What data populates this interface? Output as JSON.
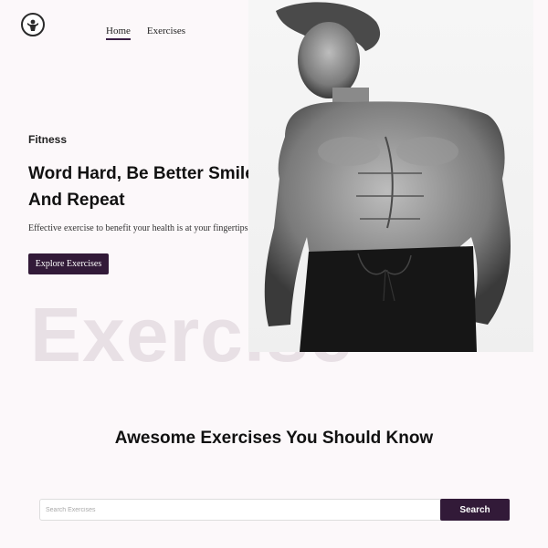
{
  "nav": {
    "home": "Home",
    "exercises": "Exercises"
  },
  "hero": {
    "subtitle": "Fitness",
    "title": "Word Hard, Be Better Smile And Repeat",
    "description": "Effective exercise to benefit your health is at your fingertips",
    "button": "Explore Exercises",
    "background_word": "Exercise"
  },
  "section": {
    "title": "Awesome Exercises You Should Know"
  },
  "search": {
    "placeholder": "Search Exercises",
    "value": "",
    "button": "Search"
  },
  "colors": {
    "accent": "#321a38",
    "background": "#fcf8fa",
    "watermark": "#e8e0e5"
  },
  "icons": {
    "logo": "gym-logo-icon"
  }
}
